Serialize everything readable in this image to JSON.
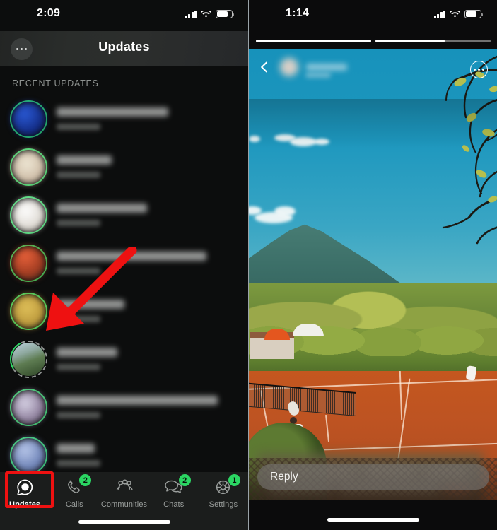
{
  "left_phone": {
    "status_bar": {
      "time": "2:09",
      "signal_icon": "cellular-bars-icon",
      "wifi_icon": "wifi-icon",
      "battery_icon": "battery-icon"
    },
    "header": {
      "title": "Updates",
      "more_button_label": "•••"
    },
    "section_label": "RECENT UPDATES",
    "updates": [
      {
        "name": "",
        "time": "",
        "ring": "unread",
        "avatar_color": "#1b3fa8",
        "name_width": 158
      },
      {
        "name": "",
        "time": "",
        "ring": "unread",
        "avatar_color": "#d3cbb4",
        "name_width": 78
      },
      {
        "name": "",
        "time": "",
        "ring": "unread",
        "avatar_color": "#e4e2dd",
        "name_width": 128
      },
      {
        "name": "",
        "time": "",
        "ring": "unread",
        "avatar_color": "#b94a2e",
        "name_width": 212
      },
      {
        "name": "",
        "time": "",
        "ring": "unread",
        "avatar_color": "#c8a43e",
        "name_width": 96
      },
      {
        "name": "",
        "time": "",
        "ring": "partial",
        "avatar_color": "#7d9aa8",
        "name_width": 86,
        "highlighted": true
      },
      {
        "name": "",
        "time": "",
        "ring": "unread",
        "avatar_color": "#7f7f9a",
        "name_width": 228
      },
      {
        "name": "",
        "time": "",
        "ring": "unread",
        "avatar_color": "#8094c2",
        "name_width": 54
      }
    ],
    "tabs": [
      {
        "label": "Updates",
        "icon": "signal-logo-icon",
        "badge": "",
        "active": true
      },
      {
        "label": "Calls",
        "icon": "phone-icon",
        "badge": "2",
        "active": false
      },
      {
        "label": "Communities",
        "icon": "people-group-icon",
        "badge": "",
        "active": false
      },
      {
        "label": "Chats",
        "icon": "chat-bubbles-icon",
        "badge": "2",
        "active": false
      },
      {
        "label": "Settings",
        "icon": "gear-icon",
        "badge": "1",
        "active": false
      }
    ],
    "annotation": {
      "arrow": "red-arrow-pointing-to-story-avatar",
      "highlight_box": "red-box-around-updates-tab"
    }
  },
  "right_phone": {
    "status_bar": {
      "time": "1:14",
      "signal_icon": "cellular-bars-icon",
      "wifi_icon": "wifi-icon",
      "battery_icon": "battery-icon"
    },
    "story": {
      "progress_segments": [
        100,
        60
      ],
      "back_icon": "chevron-left-icon",
      "more_icon": "more-options-icon",
      "poster_name": "",
      "poster_time": "",
      "caption": "",
      "media_description": "tennis court with players, mountain and blue sky"
    },
    "reply": {
      "placeholder": "Reply"
    }
  },
  "colors": {
    "accent_green": "#2bd663",
    "annotation_red": "#ee1111",
    "tabbar_bg": "#1b1d1c",
    "list_bg": "#0c0d0d"
  }
}
